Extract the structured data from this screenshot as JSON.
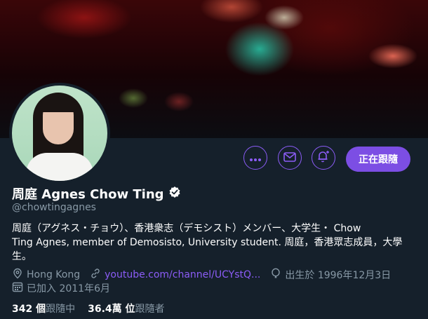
{
  "profile": {
    "name": "周庭 Agnes Chow Ting",
    "handle": "@chowtingagnes",
    "bio_line1": "周庭（アグネス・チョウ）、香港衆志（デモシスト）メンバー、大学生・ Chow",
    "bio_line2": "Ting Agnes, member of Demosisto, University student. 周庭，香港眾志成員，大學",
    "bio_line3": "生。",
    "location": "Hong Kong",
    "website": "youtube.com/channel/UCYstQ...",
    "birthday": "出生於 1996年12月3日",
    "joined": "已加入 2011年6月"
  },
  "actions": {
    "follow_label": "正在跟隨"
  },
  "stats": {
    "following_count": "342 個",
    "following_label": "跟隨中",
    "followers_count": "36.4萬 位",
    "followers_label": "跟隨者"
  },
  "colors": {
    "background": "#15202b",
    "accent": "#7c4ee4",
    "muted": "#8899a6"
  },
  "icons": [
    "more-icon",
    "envelope-icon",
    "bell-plus-icon",
    "verified-icon",
    "location-icon",
    "link-icon",
    "balloon-icon",
    "calendar-icon"
  ]
}
